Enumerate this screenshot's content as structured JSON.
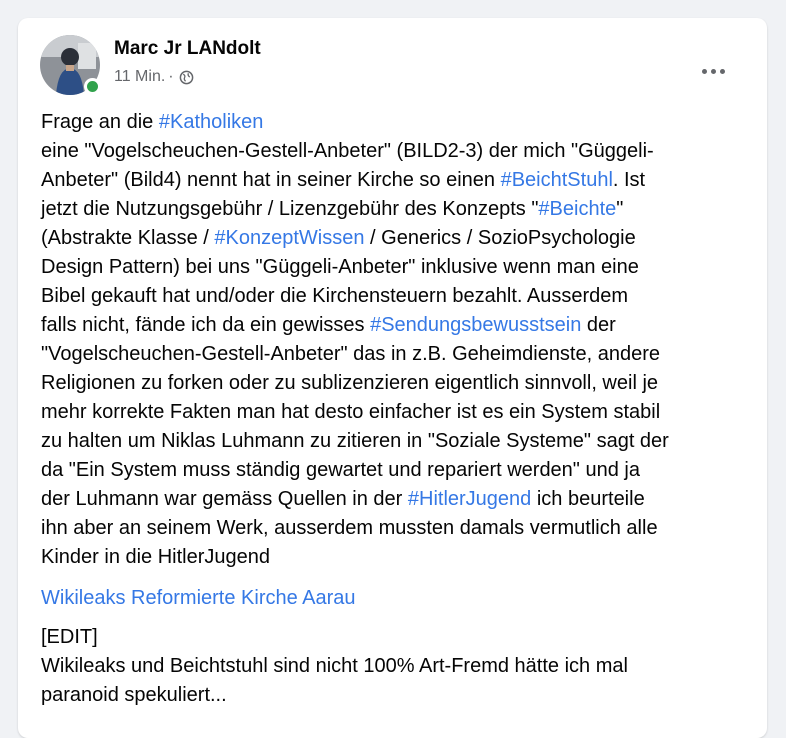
{
  "post": {
    "author": "Marc Jr LANdolt",
    "time": "11 Min.",
    "separator": "·",
    "privacy_icon": "globe-icon",
    "more_icon": "more-options-icon",
    "online_color": "#31a24c",
    "link_color": "#3578e5",
    "body_lines": [
      [
        {
          "t": "Frage an die "
        },
        {
          "t": "#Katholiken",
          "tag": true
        }
      ],
      [
        {
          "t": "eine \"Vogelscheuchen-Gestell-Anbeter\" (BILD2-3) der mich \"Güggeli-"
        }
      ],
      [
        {
          "t": "Anbeter\" (Bild4) nennt hat in seiner Kirche so einen "
        },
        {
          "t": "#BeichtStuhl",
          "tag": true
        },
        {
          "t": ". Ist"
        }
      ],
      [
        {
          "t": "jetzt die Nutzungsgebühr / Lizenzgebühr des Konzepts \""
        },
        {
          "t": "#Beichte",
          "tag": true
        },
        {
          "t": "\""
        }
      ],
      [
        {
          "t": "(Abstrakte Klasse / "
        },
        {
          "t": "#KonzeptWissen",
          "tag": true
        },
        {
          "t": " / Generics / SozioPsychologie"
        }
      ],
      [
        {
          "t": "Design Pattern) bei uns \"Güggeli-Anbeter\" inklusive wenn man eine"
        }
      ],
      [
        {
          "t": "Bibel gekauft hat und/oder die Kirchensteuern bezahlt. Ausserdem"
        }
      ],
      [
        {
          "t": "falls nicht, fände ich da ein gewisses "
        },
        {
          "t": "#Sendungsbewusstsein",
          "tag": true
        },
        {
          "t": " der"
        }
      ],
      [
        {
          "t": "\"Vogelscheuchen-Gestell-Anbeter\" das in z.B. Geheimdienste, andere"
        }
      ],
      [
        {
          "t": "Religionen zu forken oder zu sublizenzieren eigentlich sinnvoll, weil je"
        }
      ],
      [
        {
          "t": "mehr korrekte Fakten man hat desto einfacher ist es ein System stabil"
        }
      ],
      [
        {
          "t": "zu halten um Niklas Luhmann zu zitieren in \"Soziale Systeme\" sagt der"
        }
      ],
      [
        {
          "t": "da \"Ein System muss ständig gewartet und repariert werden\" und ja"
        }
      ],
      [
        {
          "t": "der Luhmann war gemäss Quellen in der "
        },
        {
          "t": "#HitlerJugend",
          "tag": true
        },
        {
          "t": " ich beurteile"
        }
      ],
      [
        {
          "t": "ihn aber an seinem Werk, ausserdem mussten damals vermutlich alle"
        }
      ],
      [
        {
          "t": "Kinder in die HitlerJugend"
        }
      ]
    ],
    "link_text": "Wikileaks Reformierte Kirche Aarau",
    "edit_lines": [
      "[EDIT]",
      "Wikileaks und Beichtstuhl sind nicht 100% Art-Fremd hätte ich mal",
      "paranoid spekuliert..."
    ]
  }
}
